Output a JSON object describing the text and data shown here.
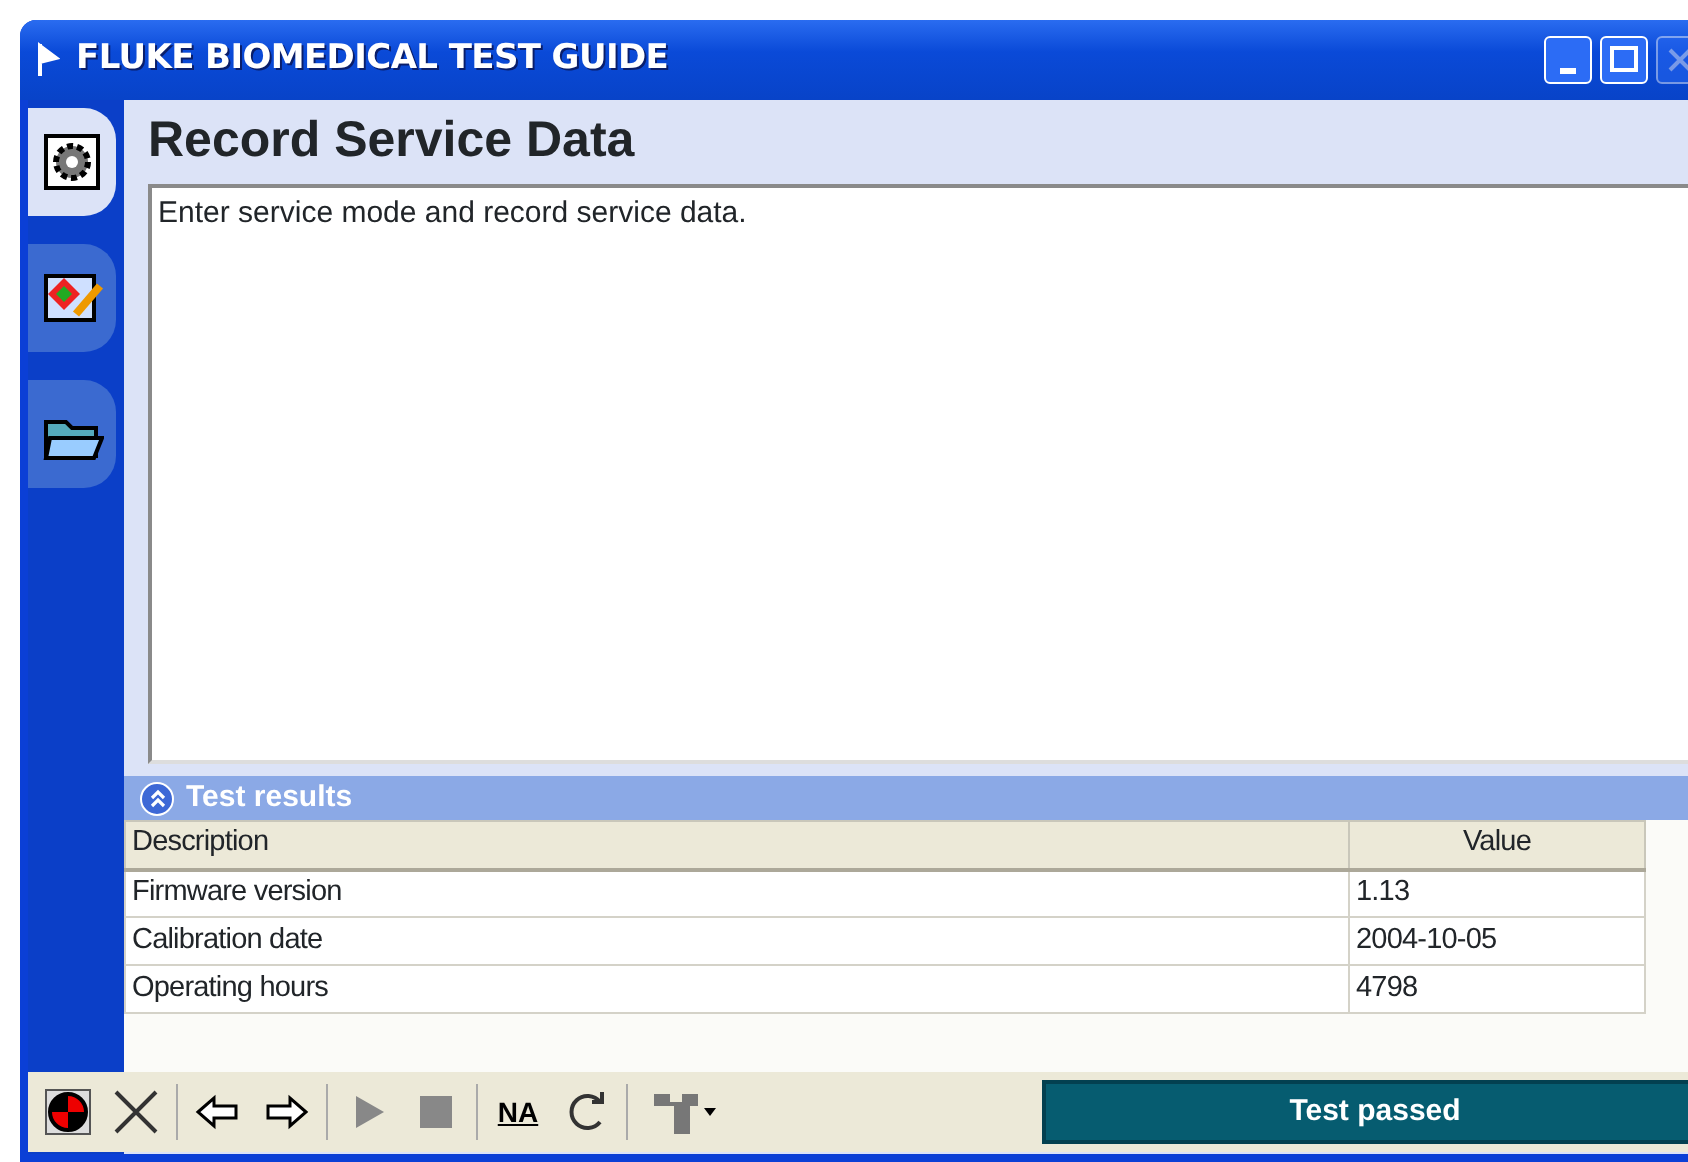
{
  "window": {
    "title": "FLUKE BIOMEDICAL TEST GUIDE",
    "controls": [
      {
        "kind": "minimize",
        "disabled": false
      },
      {
        "kind": "maximize",
        "disabled": false
      },
      {
        "kind": "close",
        "disabled": true
      }
    ]
  },
  "side_tabs": [
    {
      "kind": "gear",
      "selected": true
    },
    {
      "kind": "paint",
      "selected": false
    },
    {
      "kind": "folder",
      "selected": false
    }
  ],
  "heading": "Record Service Data",
  "instructions": "Enter service mode and record service data.",
  "results": {
    "title": "Test results",
    "expanded": true,
    "columns": [
      "Description",
      "Value"
    ],
    "rows": [
      [
        "Firmware version",
        "1.13"
      ],
      [
        "Calibration date",
        "2004-10-05"
      ],
      [
        "Operating hours",
        "4798"
      ]
    ]
  },
  "toolbar": [
    {
      "kind": "target"
    },
    {
      "kind": "cross"
    },
    {
      "kind": "sep"
    },
    {
      "kind": "left"
    },
    {
      "kind": "right"
    },
    {
      "kind": "sep"
    },
    {
      "kind": "play"
    },
    {
      "kind": "stop"
    },
    {
      "kind": "sep"
    },
    {
      "kind": "na",
      "label": "NA"
    },
    {
      "kind": "loop"
    },
    {
      "kind": "sep"
    },
    {
      "kind": "tool"
    }
  ],
  "status": "Test passed"
}
